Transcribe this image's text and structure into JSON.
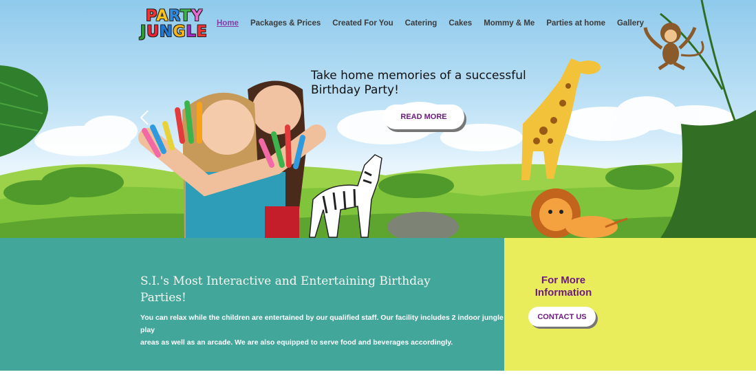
{
  "logo": {
    "line1": [
      "P",
      "A",
      "R",
      "T",
      "Y"
    ],
    "line2": [
      "J",
      "U",
      "N",
      "G",
      "L",
      "E"
    ]
  },
  "nav": {
    "items": [
      "Home",
      "Packages & Prices",
      "Created For You",
      "Catering",
      "Cakes",
      "Mommy & Me",
      "Parties at home",
      "Gallery"
    ],
    "active": "Home"
  },
  "slider": {
    "headline_line1": "Take home memories of a successful",
    "headline_line2": "Birthday Party!",
    "button_label": "READ MORE"
  },
  "banner": {
    "title_line1": "S.I.'s Most Interactive and Entertaining Birthday",
    "title_line2": "Parties!",
    "text_line1": "You can relax while the children are entertained by our qualified staff. Our facility includes 2 indoor jungle play",
    "text_line2": "areas as well as an arcade. We are also equipped to serve food and beverages accordingly.",
    "more_line1": "For More",
    "more_line2": "Information",
    "contact_label": "CONTACT US"
  },
  "colors": {
    "teal": "#43a69b",
    "yellow": "#e9ec5b",
    "purple": "#6b1a7e",
    "nav_active": "#8a3aa6"
  }
}
